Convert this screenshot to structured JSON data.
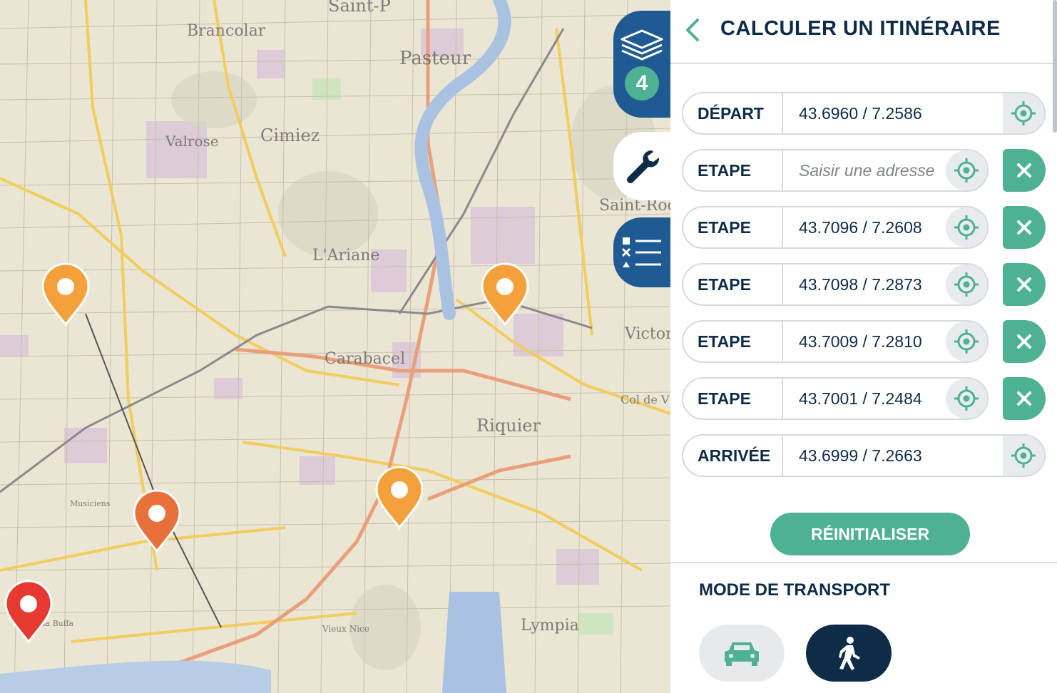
{
  "map": {
    "labels": [
      "Saint-P",
      "Brancolar",
      "Pasteur",
      "Cimiez",
      "Valrose",
      "Riquier",
      "Saint-Roc",
      "L'Ariane",
      "Carabacel",
      "Victor",
      "Musiciens",
      "la Buffa",
      "Vieux Nice",
      "Lympia",
      "Col de V"
    ],
    "marker_colors": {
      "orange": "#f4a13b",
      "dark_orange": "#e8703a",
      "red": "#e63a30"
    }
  },
  "toolbar": {
    "layers_icon": "layers-icon",
    "layers_count": "4",
    "tools_icon": "wrench-icon",
    "list_icon": "checklist-icon"
  },
  "panel": {
    "title": "CALCULER UN ITINÉRAIRE",
    "back_icon": "chevron-left-icon",
    "rows": [
      {
        "label": "DÉPART",
        "value": "43.6960 / 7.2586",
        "placeholder": ""
      },
      {
        "label": "ETAPE",
        "value": "",
        "placeholder": "Saisir une adresse"
      },
      {
        "label": "ETAPE",
        "value": "43.7096 / 7.2608",
        "placeholder": ""
      },
      {
        "label": "ETAPE",
        "value": "43.7098 / 7.2873",
        "placeholder": ""
      },
      {
        "label": "ETAPE",
        "value": "43.7009 / 7.2810",
        "placeholder": ""
      },
      {
        "label": "ETAPE",
        "value": "43.7001 / 7.2484",
        "placeholder": ""
      },
      {
        "label": "ARRIVÉE",
        "value": "43.6999 / 7.2663",
        "placeholder": ""
      }
    ],
    "reset_label": "RÉINITIALISER",
    "transport_title": "MODE DE TRANSPORT",
    "modes": [
      {
        "name": "car",
        "icon": "car-icon",
        "selected": false
      },
      {
        "name": "walk",
        "icon": "pedestrian-icon",
        "selected": true
      }
    ]
  },
  "colors": {
    "accent": "#4eb193",
    "navy": "#0e2c47",
    "tab_blue": "#1f5a93"
  }
}
